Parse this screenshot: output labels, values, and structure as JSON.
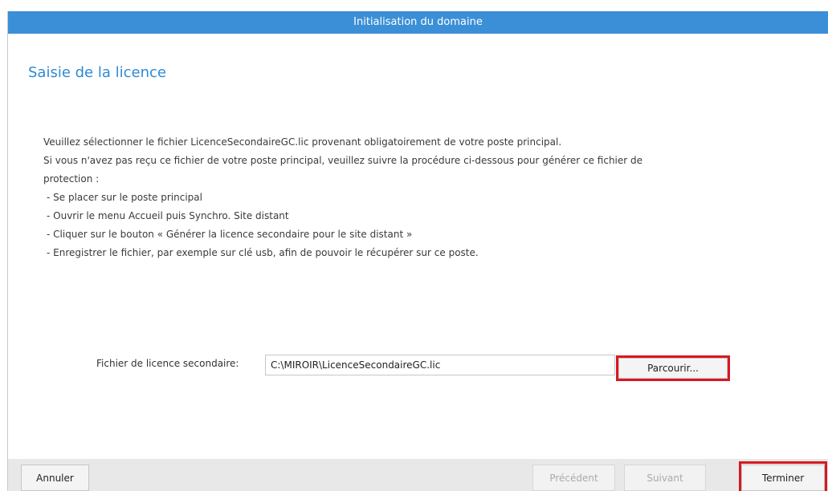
{
  "window": {
    "title": "Initialisation du domaine"
  },
  "section": {
    "title": "Saisie de la licence"
  },
  "instructions": {
    "lines": [
      "Veuillez sélectionner le fichier LicenceSecondaireGC.lic provenant obligatoirement de votre poste principal.",
      "Si vous n'avez pas reçu ce fichier de votre poste principal, veuillez suivre la procédure ci-dessous pour générer ce fichier de",
      "protection :"
    ],
    "steps": [
      "- Se placer sur le poste principal",
      "- Ouvrir le menu Accueil puis Synchro. Site distant",
      "- Cliquer sur le bouton « Générer la licence secondaire pour le site distant »",
      "- Enregistrer le fichier, par exemple sur clé usb, afin de pouvoir le récupérer sur ce poste."
    ]
  },
  "license_file": {
    "label": "Fichier de licence secondaire:",
    "value": "C:\\MIROIR\\LicenceSecondaireGC.lic",
    "browse_label": "Parcourir..."
  },
  "footer": {
    "cancel_label": "Annuler",
    "previous_label": "Précédent",
    "next_label": "Suivant",
    "finish_label": "Terminer"
  },
  "colors": {
    "titlebar": "#3b8fd6",
    "section_title": "#2e8ad4",
    "highlight": "#d61921",
    "footer": "#e8e8e8"
  }
}
